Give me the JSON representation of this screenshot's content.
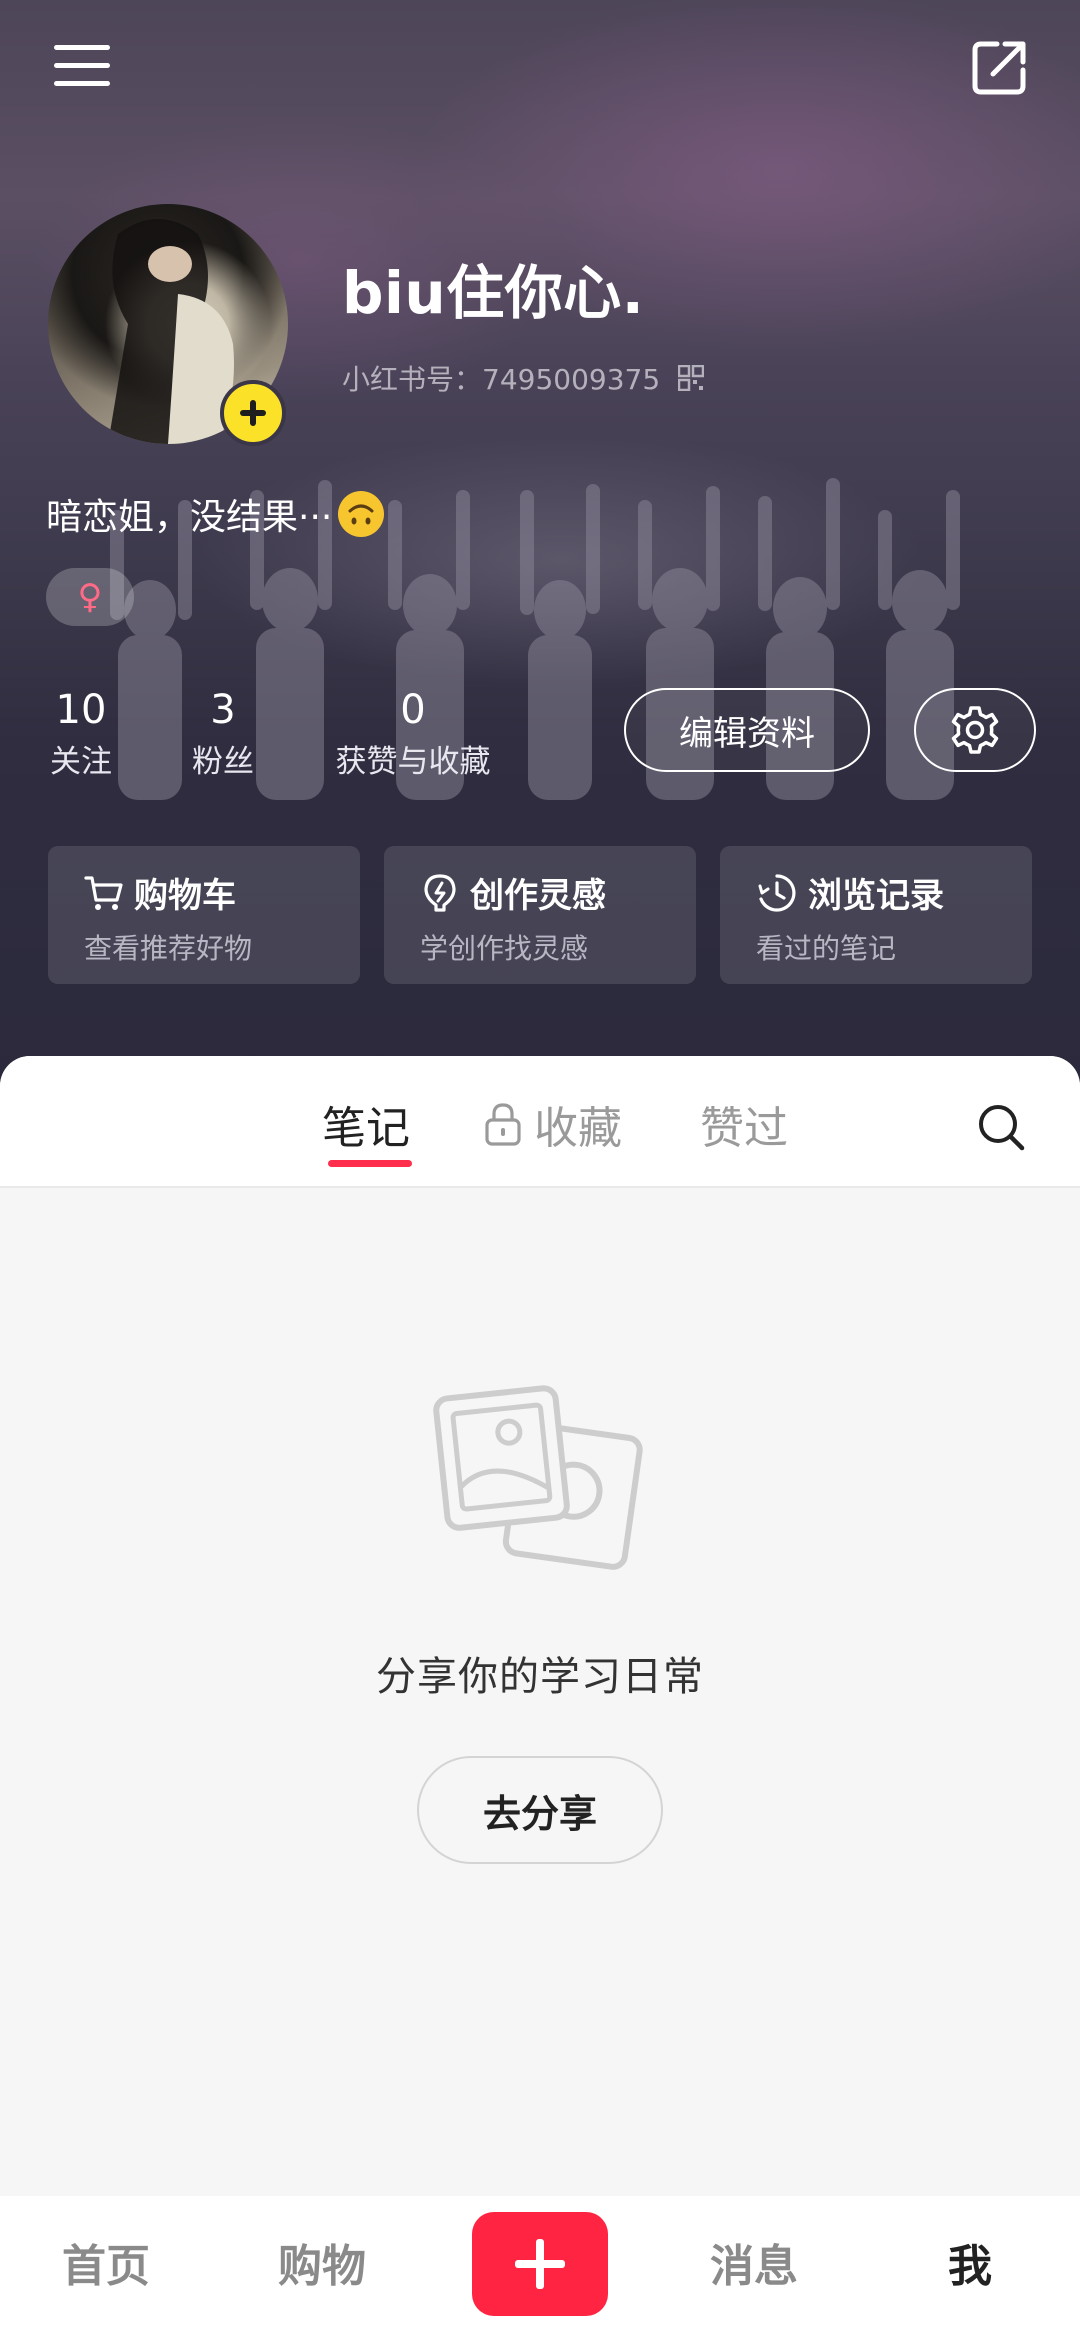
{
  "header": {
    "menu_icon": "menu-icon",
    "share_icon": "external-share-icon"
  },
  "profile": {
    "username": "biu住你心.",
    "id_label": "小红书号：7495009375",
    "bio": "暗恋姐，没结果···",
    "bio_emoji": "upside-down-face",
    "gender_symbol": "♀"
  },
  "stats": [
    {
      "value": "10",
      "label": "关注"
    },
    {
      "value": "3",
      "label": "粉丝"
    },
    {
      "value": "0",
      "label": "获赞与收藏"
    }
  ],
  "actions": {
    "edit_label": "编辑资料",
    "settings_icon": "gear-icon"
  },
  "cards": [
    {
      "title": "购物车",
      "subtitle": "查看推荐好物",
      "icon": "cart-icon"
    },
    {
      "title": "创作灵感",
      "subtitle": "学创作找灵感",
      "icon": "lightbulb-icon"
    },
    {
      "title": "浏览记录",
      "subtitle": "看过的笔记",
      "icon": "clock-icon"
    }
  ],
  "tabs": [
    {
      "label": "笔记",
      "active": true
    },
    {
      "label": "收藏",
      "locked": true
    },
    {
      "label": "赞过"
    }
  ],
  "empty_state": {
    "text": "分享你的学习日常",
    "button": "去分享"
  },
  "bottom_nav": [
    {
      "label": "首页"
    },
    {
      "label": "购物"
    },
    {
      "label": "消息"
    },
    {
      "label": "我",
      "active": true
    }
  ],
  "colors": {
    "accent": "#ff2442",
    "tab_underline": "#ff2e4d",
    "avatar_badge": "#fbe228",
    "gender": "#ff6b86"
  }
}
